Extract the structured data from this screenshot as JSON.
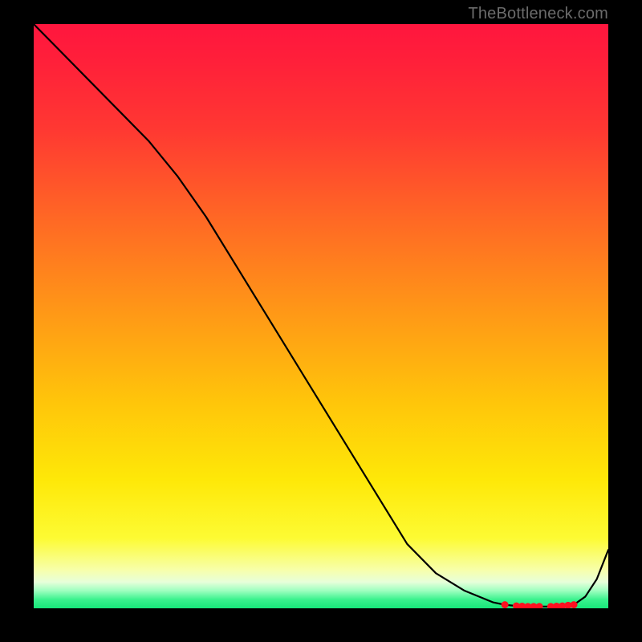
{
  "watermark": "TheBottleneck.com",
  "chart_data": {
    "type": "line",
    "title": "",
    "xlabel": "",
    "ylabel": "",
    "xlim": [
      0,
      100
    ],
    "ylim": [
      0,
      100
    ],
    "series": [
      {
        "name": "curve",
        "x": [
          0,
          5,
          10,
          15,
          20,
          25,
          30,
          35,
          40,
          45,
          50,
          55,
          60,
          65,
          70,
          75,
          80,
          82,
          84,
          86,
          88,
          90,
          92,
          94,
          96,
          98,
          100
        ],
        "values": [
          100,
          95,
          90,
          85,
          80,
          74,
          67,
          59,
          51,
          43,
          35,
          27,
          19,
          11,
          6,
          3,
          1,
          0.6,
          0.4,
          0.3,
          0.3,
          0.3,
          0.4,
          0.6,
          2,
          5,
          10
        ],
        "markers_x": [
          82,
          84,
          85,
          86,
          87,
          88,
          90,
          91,
          92,
          93,
          94
        ],
        "markers_y": [
          0.6,
          0.4,
          0.35,
          0.3,
          0.3,
          0.3,
          0.3,
          0.35,
          0.4,
          0.5,
          0.6
        ]
      }
    ],
    "colors": {
      "line": "#000000",
      "marker": "#ff1020",
      "top_gradient": "#ff163e",
      "bottom_gradient": "#17e77a"
    }
  }
}
